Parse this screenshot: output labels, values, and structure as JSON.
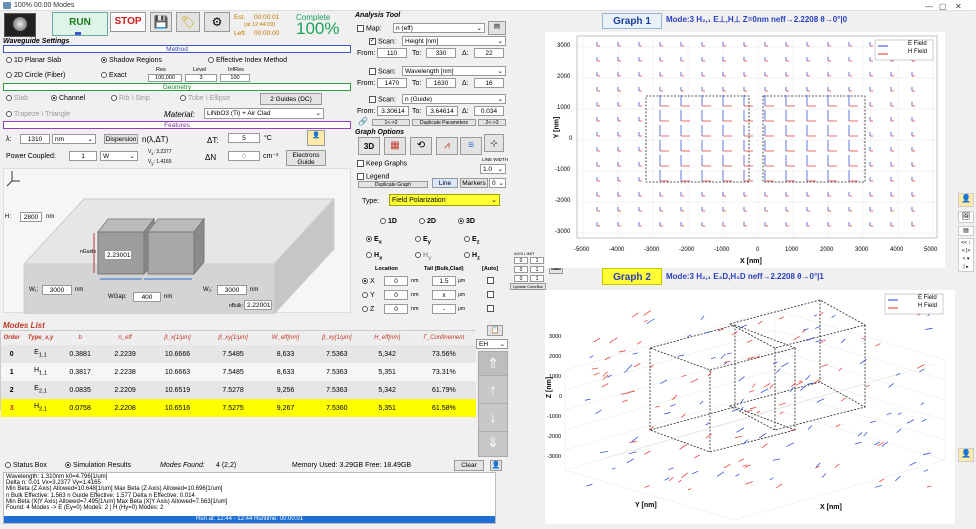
{
  "window": {
    "title": "100%  00:00 Modes",
    "min": "—",
    "restore": "▢",
    "close": "✕"
  },
  "toolbar": {
    "run": "RUN",
    "stop": "STOP",
    "est_label": "Est.",
    "est_time": "00:00:01",
    "est_at": "(at 12:44:09)",
    "left_label": "Left:",
    "left_time": "00:00:00",
    "complete_label": "Complete",
    "complete_pct": "100%"
  },
  "waveguide_settings": "Waveguide Settings",
  "method": {
    "header": "Method",
    "planar": "1D Planar Slab",
    "shadow": "Shadow Regions",
    "eim": "Effective Index Method",
    "circle": "2D Circle (Fiber)",
    "exact": "Exact",
    "res_label": "Res",
    "level_label": "Level",
    "infres_label": "InfRes",
    "res": "100,000",
    "level": "3",
    "infres": "100"
  },
  "geometry": {
    "header": "Geometry",
    "slab": "Slab",
    "channel": "Channel",
    "rib": "Rib \\ Strip",
    "tube": "Tube \\ Ellipse",
    "guides_btn": "2 Guides (DC)",
    "trapeze": "Trapeze \\ Triangle",
    "material_label": "Material:",
    "material": "LiNbO3 (Ti) + Air Clad"
  },
  "features": {
    "header": "Features",
    "lambda_label": "λ:",
    "lambda": "1310",
    "lambda_unit": "nm",
    "dispersion_btn": "Dispersion",
    "n_lambda": "n(λ,ΔT)",
    "dT_label": "ΔT:",
    "dT": "5",
    "dT_unit": "°C",
    "power_label": "Power Coupled:",
    "power": "1",
    "power_unit": "W",
    "vx": "3.2377",
    "vy": "1.4165",
    "dN_label": "ΔN",
    "dN": "0",
    "dN_unit": "cm⁻³",
    "electrons_btn": "Electrons Guide"
  },
  "diagram": {
    "h_label": "H:",
    "h": "2800",
    "h_unit": "nm",
    "nguide_label": "nGuide",
    "nguide": "2.23001",
    "w1_label": "W₁:",
    "w1": "3000",
    "w1_unit": "nm",
    "wgap_label": "WGap:",
    "wgap": "400",
    "wgap_unit": "nm",
    "w2_label": "W₂:",
    "w2": "3000",
    "w2_unit": "nm",
    "nbulk_label": "nBulk:",
    "nbulk": "2.22001"
  },
  "modes": {
    "title": "Modes List",
    "headers": [
      "Order",
      "Type_x,y",
      "b",
      "n_eff",
      "β_x[1/μm]",
      "β_xy[1/μm]",
      "W_eff[nm]",
      "β_xy[1/μm]",
      "H_eff[nm]",
      "Γ_Confinement"
    ],
    "rows": [
      {
        "order": "0",
        "type": "E",
        "sub": "1,1",
        "b": "0.3881",
        "neff": "2.2239",
        "bx": "10.6666",
        "bxy": "7.5485",
        "weff": "8,633",
        "by": "7.5363",
        "heff": "5,342",
        "conf": "73.56%"
      },
      {
        "order": "1",
        "type": "H",
        "sub": "1,1",
        "b": "0.3817",
        "neff": "2.2238",
        "bx": "10.6663",
        "bxy": "7.5485",
        "weff": "8,633",
        "by": "7.5363",
        "heff": "5,351",
        "conf": "73.31%"
      },
      {
        "order": "2",
        "type": "E",
        "sub": "2,1",
        "b": "0.0835",
        "neff": "2.2209",
        "bx": "10.6519",
        "bxy": "7.5278",
        "weff": "9,256",
        "by": "7.5363",
        "heff": "5,342",
        "conf": "61.79%"
      },
      {
        "order": "3",
        "type": "H",
        "sub": "2,1",
        "b": "0.0758",
        "neff": "2.2208",
        "bx": "10.6516",
        "bxy": "7.5275",
        "weff": "9,267",
        "by": "7.5360",
        "heff": "5,351",
        "conf": "61.58%"
      }
    ],
    "eh_select": "EH"
  },
  "status": {
    "status_box": "Status Box",
    "sim_results": "Simulation Results",
    "modes_found_label": "Modes Found:",
    "modes_found": "4 (2,2)",
    "memory": "Memory Used: 3.29GB  Free: 18.49GB",
    "clear": "Clear",
    "log": [
      "Wavelength: 1.310nm      k0=4.796[1/um]",
      "Delta n: 0.01     Vx=3.2377      Vy=1.4165",
      "Min Beta (Z Axis) Allowed=10.648[1/um]    Max Beta (Z Axis) Allowed=10.696[1/um]",
      "n Bulk Effective: 1.563       n Guide Effective: 1.577       Delta n Effective: 0.014",
      "Min Beta (X|Y Axis) Allowed=7.495[1/um]    Max Beta (X|Y Axis) Allowed=7.563[1/um]",
      "Found: 4 Modes -> E (Ey=0) Modes: 2  |  H (Hy=0) Modes: 2"
    ],
    "footer": "Run at: 12:44 - 12:44     Runtime: 00:00:01"
  },
  "analysis": {
    "title": "Analysis Tool",
    "map_label": "Map:",
    "map_value": "n (eff)",
    "scan1_label": "Scan:",
    "scan1_value": "Height [nm]",
    "from1": "110",
    "to1": "330",
    "d1": "22",
    "scan2_label": "Scan:",
    "scan2_value": "Wavelength [nm]",
    "from2": "1470",
    "to2": "1630",
    "d2": "16",
    "scan3_label": "Scan:",
    "scan3_value": "n (Guide)",
    "from3": "3.30614",
    "to3": "3.64614",
    "d3": "0.034",
    "from_label": "From:",
    "to_label": "To:",
    "d_label": "Δ:",
    "btn_1to2": "1<->2",
    "dup_params": "Duplicate Parameters",
    "btn_2to3": "2<->3"
  },
  "graph_options": {
    "title": "Graph Options",
    "view3d": "3D",
    "keep_graphs": "Keep Graphs",
    "legend": "Legend",
    "line_width_label": "LINE WIDTH",
    "line_width": "1.0",
    "dup_graph": "Duplicate Graph",
    "line_btn": "Line",
    "markers": "Markers",
    "markers_val": "0",
    "type_label": "Type:",
    "type_value": "Field Polarization",
    "d1": "1D",
    "d2": "2D",
    "d3": "3D",
    "comp_ex": "E",
    "comp_ey": "E",
    "comp_ez": "E",
    "comp_hx": "H",
    "comp_hy": "H",
    "comp_hz": "H",
    "sub_x": "x",
    "sub_y": "y",
    "sub_z": "z",
    "loc_label": "Location",
    "tail_label": "Tail (Bulk,Clad)",
    "auto_label": "[Auto]",
    "x_label": "X",
    "y_label": "Y",
    "z_label": "Z",
    "x_val": "0",
    "y_val": "0",
    "z_val": "0",
    "unit": "nm",
    "x_tail": "1.5",
    "y_tail": "x",
    "z_tail": "-",
    "axis_limit": "AXIS LIMIT",
    "al_vals": [
      "0",
      "1",
      "0",
      "1",
      "0",
      "1"
    ],
    "update_colorbar": "Update ColorBar"
  },
  "graph1": {
    "title": "Graph 1",
    "mode": "Mode:3  H₂,₁  E⊥,H⊥  Z=0nm  neff→2.2208  θ→0°|0",
    "legend_e": "E Field",
    "legend_h": "H Field",
    "xlabel": "X [nm]",
    "ylabel": "Y [nm]",
    "xticks": [
      "-5000",
      "-4000",
      "-3000",
      "-2000",
      "-1000",
      "0",
      "1000",
      "2000",
      "3000",
      "4000",
      "5000"
    ],
    "yticks": [
      "3000",
      "2000",
      "1000",
      "0",
      "-1000",
      "-2000",
      "-3000"
    ]
  },
  "graph2": {
    "title": "Graph 2",
    "mode": "Mode:3  H₂,₁  E₃D,H₃D  neff→2.2208  θ→0°|1",
    "legend_e": "E Field",
    "legend_h": "H Field",
    "xlabel": "X [nm]",
    "ylabel": "Y [nm]",
    "zlabel": "Z [nm]",
    "zticks": [
      "3000",
      "2000",
      "1000",
      "0",
      "-1000",
      "-2000",
      "-3000"
    ]
  },
  "colors": {
    "accent": "#2a3fbf",
    "highlight": "#ffff00",
    "efield": "#1f3fd0",
    "hfield": "#e0302a"
  }
}
